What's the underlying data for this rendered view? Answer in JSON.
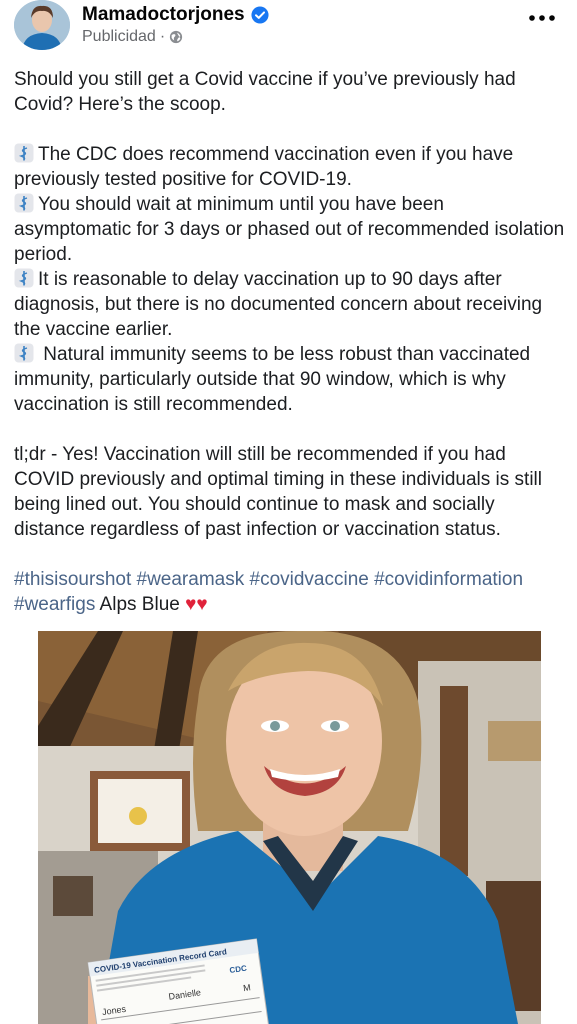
{
  "post": {
    "author": "Mamadoctorjones",
    "sponsored_label": "Publicidad",
    "separator": "·",
    "icons": {
      "verified": "verified-badge-icon",
      "audience": "globe-icon",
      "more": "more-options-icon",
      "staff": "staff-of-aesculapius-emoji"
    },
    "accent_color": "#1877f2",
    "hashtag_color": "#4b6588",
    "intro": "Should you still get a Covid vaccine if you’ve previously had Covid? Here’s the scoop.",
    "bullets": [
      "The CDC does recommend vaccination even if you have previously tested positive for COVID-19.",
      "You should wait at minimum until you have been asymptomatic for 3 days or phased out of recommended isolation period.",
      "It is reasonable to delay vaccination up to 90 days after diagnosis, but there is no documented concern about receiving the vaccine earlier.",
      " Natural immunity seems to be less robust than vaccinated immunity, particularly outside that 90 window, which is why vaccination is still recommended."
    ],
    "tldr": "tl;dr - Yes! Vaccination will still be recommended if you had COVID previously and optimal timing in these individuals is still being lined out. You should continue to mask and socially distance regardless of past infection or vaccination status.",
    "hashtags": "#thisisourshot #wearamask #covidvaccine #covidinformation #wearfigs",
    "tag_suffix": " Alps Blue ",
    "hearts": "♥♥",
    "photo": {
      "card_title": "COVID-19 Vaccination Record Card",
      "card_logo": "CDC",
      "card_last_name": "Jones",
      "card_first_name": "Danielle",
      "card_mi": "M"
    }
  }
}
